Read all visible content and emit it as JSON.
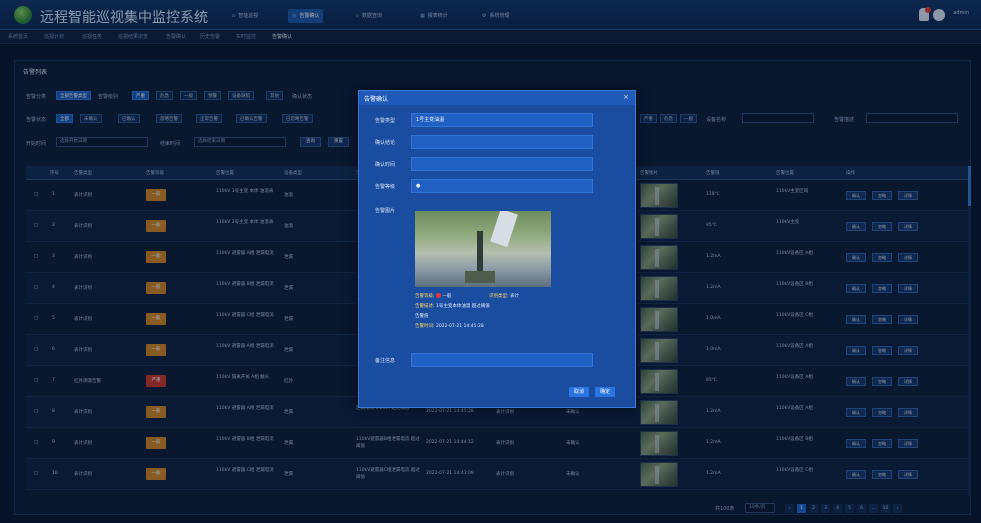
{
  "app": {
    "title": "远程智能巡视集中监控系统",
    "user": "admin"
  },
  "top_nav": [
    {
      "label": "智能巡视",
      "active": false
    },
    {
      "label": "告警确认",
      "active": true
    },
    {
      "label": "数据查询",
      "active": false
    },
    {
      "label": "报表统计",
      "active": false
    },
    {
      "label": "系统管理",
      "active": false
    }
  ],
  "subbar": [
    "系统首页",
    "巡视计划",
    "巡视任务",
    "巡视结果浏览",
    "告警确认",
    "历史告警",
    "实时监控",
    "告警确认"
  ],
  "panel": {
    "title": "告警列表"
  },
  "filters": {
    "row1_label": "告警分类",
    "row1_chips": [
      "全部告警类型",
      "告警级别",
      "严重",
      "危急",
      "一般",
      "预警",
      "设备缺陷",
      "其他",
      "确认状态"
    ],
    "row2_label": "告警状态",
    "row2_chips": [
      "全部",
      "未确认",
      "已确认",
      "忽略告警",
      "正常告警",
      "已确认告警",
      "已忽略告警"
    ],
    "row3_label": "开始时间",
    "start_placeholder": "选择开始日期",
    "end_label": "结束时间",
    "end_placeholder": "选择结束日期",
    "query_button": "查询",
    "reset_button": "重置",
    "right_chips": [
      "严重",
      "危急",
      "一般"
    ],
    "right_label": "设备名称",
    "search_label": "告警描述"
  },
  "table": {
    "headers": [
      "序号",
      "告警类型",
      "告警等级",
      "告警位置",
      "设备类型",
      "告警描述",
      "告警时间",
      "识别类型",
      "确认状态",
      "告警图片",
      "告警值",
      "告警位置",
      "操作"
    ],
    "rows": [
      {
        "no": "1",
        "type": "表计识别",
        "level": "一般",
        "level_color": "orange",
        "pos": "110kV 1号主变 本体 油温表",
        "dtype": "油温",
        "desc": "",
        "time": "",
        "rec": "",
        "status": "",
        "value": "118℃",
        "loc": "110kV主变区域",
        "ops": [
          "确认",
          "忽略",
          "详情"
        ]
      },
      {
        "no": "2",
        "type": "表计识别",
        "level": "一般",
        "level_color": "orange",
        "pos": "110kV 2号主变 本体 油温表",
        "dtype": "油温",
        "desc": "",
        "time": "",
        "rec": "",
        "status": "",
        "value": "95℃",
        "loc": "110kV主变",
        "ops": [
          "确认",
          "忽略",
          "详情"
        ]
      },
      {
        "no": "3",
        "type": "表计识别",
        "level": "一般",
        "level_color": "orange",
        "pos": "110kV 避雷器 A相 泄漏电流",
        "dtype": "泄漏",
        "desc": "",
        "time": "",
        "rec": "",
        "status": "",
        "value": "1.2mA",
        "loc": "110kV设备区 A相",
        "ops": [
          "确认",
          "忽略",
          "详情"
        ]
      },
      {
        "no": "4",
        "type": "表计识别",
        "level": "一般",
        "level_color": "orange",
        "pos": "110kV 避雷器 B相 泄漏电流",
        "dtype": "泄漏",
        "desc": "",
        "time": "",
        "rec": "",
        "status": "",
        "value": "1.2mA",
        "loc": "110kV设备区 B相",
        "ops": [
          "确认",
          "忽略",
          "详情"
        ]
      },
      {
        "no": "5",
        "type": "表计识别",
        "level": "一般",
        "level_color": "orange",
        "pos": "110kV 避雷器 C相 泄漏电流",
        "dtype": "泄漏",
        "desc": "",
        "time": "",
        "rec": "",
        "status": "",
        "value": "1.0mA",
        "loc": "110kV设备区 C相",
        "ops": [
          "确认",
          "忽略",
          "详情"
        ]
      },
      {
        "no": "6",
        "type": "表计识别",
        "level": "一般",
        "level_color": "orange",
        "pos": "110kV 避雷器 A相 泄漏电流",
        "dtype": "泄漏",
        "desc": "",
        "time": "",
        "rec": "",
        "status": "",
        "value": "1.0mA",
        "loc": "110kV设备区 A相",
        "ops": [
          "确认",
          "忽略",
          "详情"
        ]
      },
      {
        "no": "7",
        "type": "红外测温告警",
        "level": "严重",
        "level_color": "red",
        "pos": "110kV 隔离开关 A相 触头",
        "dtype": "红外",
        "desc": "",
        "time": "",
        "rec": "",
        "status": "",
        "value": "85℃",
        "loc": "110kV设备区 A相",
        "ops": [
          "确认",
          "忽略",
          "详情"
        ]
      },
      {
        "no": "8",
        "type": "表计识别",
        "level": "一般",
        "level_color": "orange",
        "pos": "110kV 避雷器 A相 泄漏电流",
        "dtype": "泄漏",
        "desc": "泄漏电流 1.2mA 超过阈值",
        "time": "2022-07-21 14:45:28",
        "rec": "表计识别",
        "status": "未确认",
        "value": "1.2mA",
        "loc": "110kV设备区 A相",
        "ops": [
          "确认",
          "忽略",
          "详情"
        ]
      },
      {
        "no": "9",
        "type": "表计识别",
        "level": "一般",
        "level_color": "orange",
        "pos": "110kV 避雷器 B相 泄漏电流",
        "dtype": "泄漏",
        "desc": "110kV避雷器B相泄漏电流 超过阈值",
        "time": "2022-07-21 14:44:12",
        "rec": "表计识别",
        "status": "未确认",
        "value": "1.2mA",
        "loc": "110kV设备区 B相",
        "ops": [
          "确认",
          "忽略",
          "详情"
        ]
      },
      {
        "no": "10",
        "type": "表计识别",
        "level": "一般",
        "level_color": "orange",
        "pos": "110kV 避雷器 C相 泄漏电流",
        "dtype": "泄漏",
        "desc": "110kV避雷器C相泄漏电流 超过阈值",
        "time": "2022-07-21 14:43:09",
        "rec": "表计识别",
        "status": "未确认",
        "value": "1.2mA",
        "loc": "110kV设备区 C相",
        "ops": [
          "确认",
          "忽略",
          "详情"
        ]
      }
    ]
  },
  "pager": {
    "total_label": "共100条",
    "page_size": "10条/页",
    "pages": [
      "1",
      "2",
      "3",
      "4",
      "5",
      "6",
      "...",
      "10"
    ],
    "prev": "‹",
    "next": "›"
  },
  "modal": {
    "title": "告警确认",
    "close": "×",
    "fields": [
      {
        "label": "告警类型",
        "value": "1号主变油温"
      },
      {
        "label": "确认结论",
        "value": ""
      },
      {
        "label": "确认时间",
        "value": ""
      },
      {
        "label": "告警等级",
        "value": "●"
      }
    ],
    "image_label": "告警图片",
    "detail_level_label": "告警等级:",
    "detail_level_value": "一般",
    "detail_type_label": "识别类型:",
    "detail_type_value": "表计",
    "detail_desc_label": "告警描述:",
    "detail_desc_value": "1号主变本体油温 超过阈值",
    "detail_desc_value2": "告警值",
    "detail_time_label": "告警时间:",
    "detail_time_value": "2022-07-21 14:45:28",
    "remark_label": "备注信息",
    "cancel": "取消",
    "confirm": "确定"
  }
}
